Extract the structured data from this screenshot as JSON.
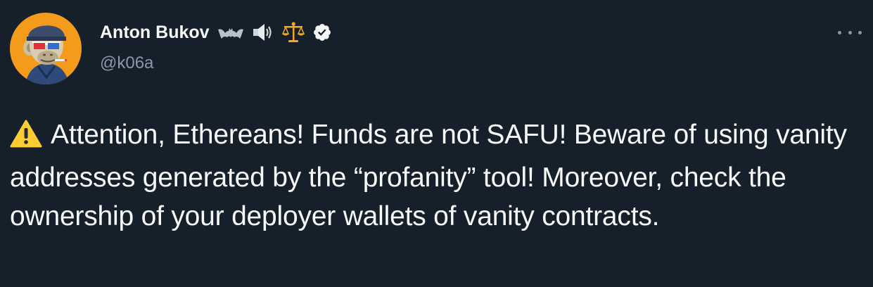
{
  "tweet": {
    "author": {
      "display_name": "Anton Bukov",
      "handle": "@k06a",
      "avatar_icon": "bored-ape-avatar",
      "name_emojis": [
        "bat-icon",
        "speaker-icon",
        "scales-icon",
        "verified-badge-icon"
      ]
    },
    "more_icon": "more-options-icon",
    "body": {
      "leading_icon": "warning-icon",
      "text": "Attention, Ethereans! Funds are not SAFU! Beware of using vanity addresses generated by the “profanity” tool! Moreover, check the ownership of your deployer wallets of vanity contracts."
    }
  },
  "colors": {
    "background": "#15202b",
    "text_primary": "#f7f9f9",
    "text_secondary": "#8b98a5",
    "avatar_bg": "#f59b1c",
    "warning_yellow": "#ffcc33",
    "scales_gold": "#f5a623"
  }
}
